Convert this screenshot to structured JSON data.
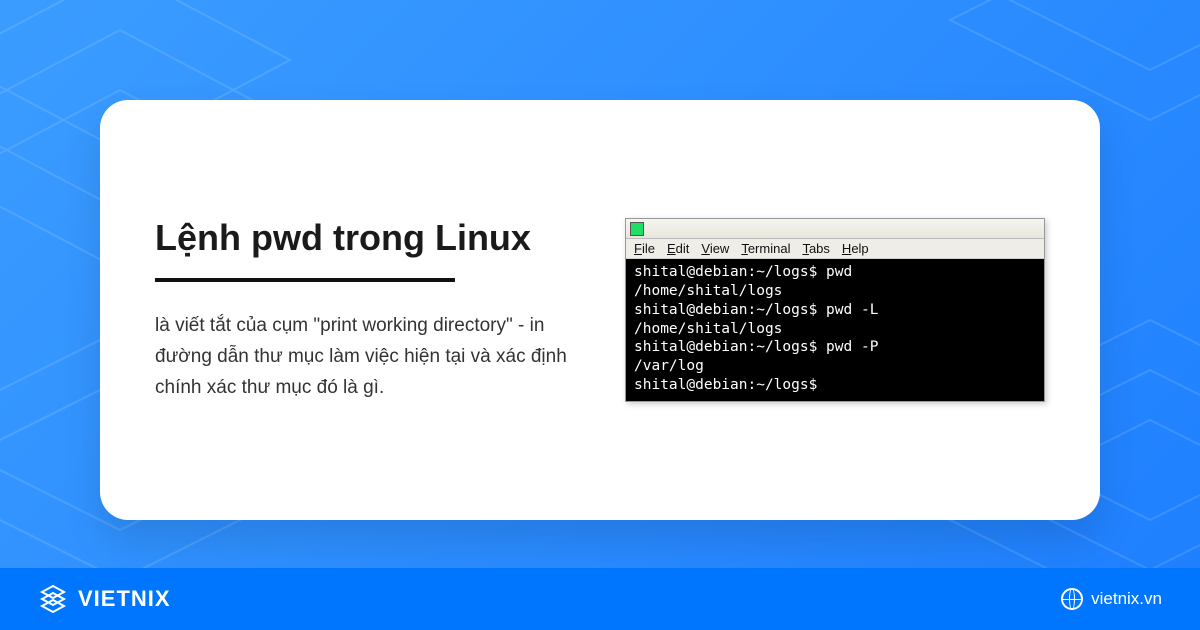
{
  "card": {
    "title": "Lệnh pwd trong Linux",
    "description": "là viết tắt của cụm \"print working directory\" - in đường dẫn thư mục làm việc hiện tại và xác định chính xác thư mục đó là gì."
  },
  "terminal": {
    "menu": [
      "File",
      "Edit",
      "View",
      "Terminal",
      "Tabs",
      "Help"
    ],
    "lines": [
      "shital@debian:~/logs$ pwd",
      "/home/shital/logs",
      "shital@debian:~/logs$ pwd -L",
      "/home/shital/logs",
      "shital@debian:~/logs$ pwd -P",
      "/var/log",
      "shital@debian:~/logs$"
    ]
  },
  "footer": {
    "brand": "VIETNIX",
    "url": "vietnix.vn"
  }
}
